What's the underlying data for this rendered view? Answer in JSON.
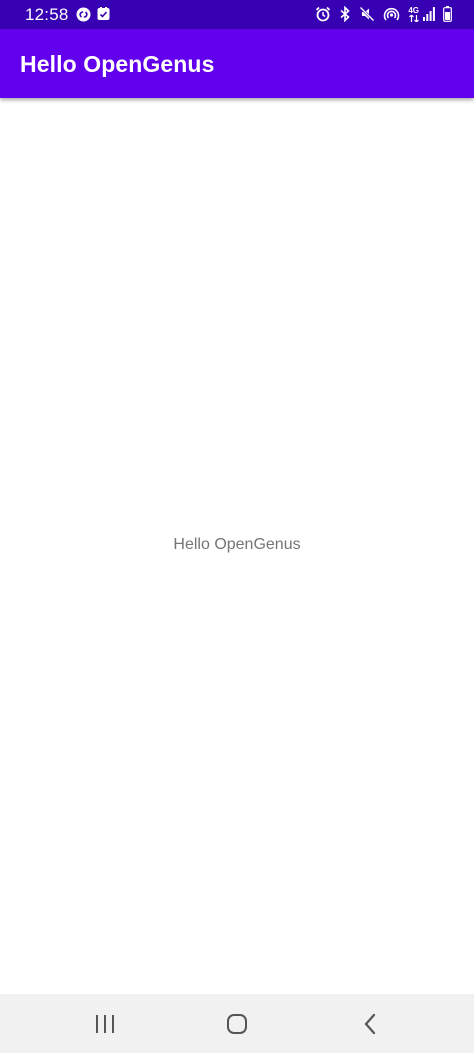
{
  "status_bar": {
    "time": "12:58",
    "network": "4G",
    "left_icons": [
      "shazam-icon",
      "checkbox-icon"
    ],
    "right_icons": [
      "alarm-icon",
      "bluetooth-icon",
      "mute-icon",
      "hotspot-icon",
      "network-4g-icon",
      "signal-icon",
      "battery-icon"
    ]
  },
  "app_bar": {
    "title": "Hello OpenGenus"
  },
  "main": {
    "text": "Hello OpenGenus"
  },
  "nav_bar": {
    "buttons": [
      "recents-icon",
      "home-icon",
      "back-icon"
    ]
  },
  "colors": {
    "status_bar": "#3700b3",
    "app_bar": "#6200ee",
    "content_text": "#757575",
    "nav_bar": "#f1f1f1"
  }
}
